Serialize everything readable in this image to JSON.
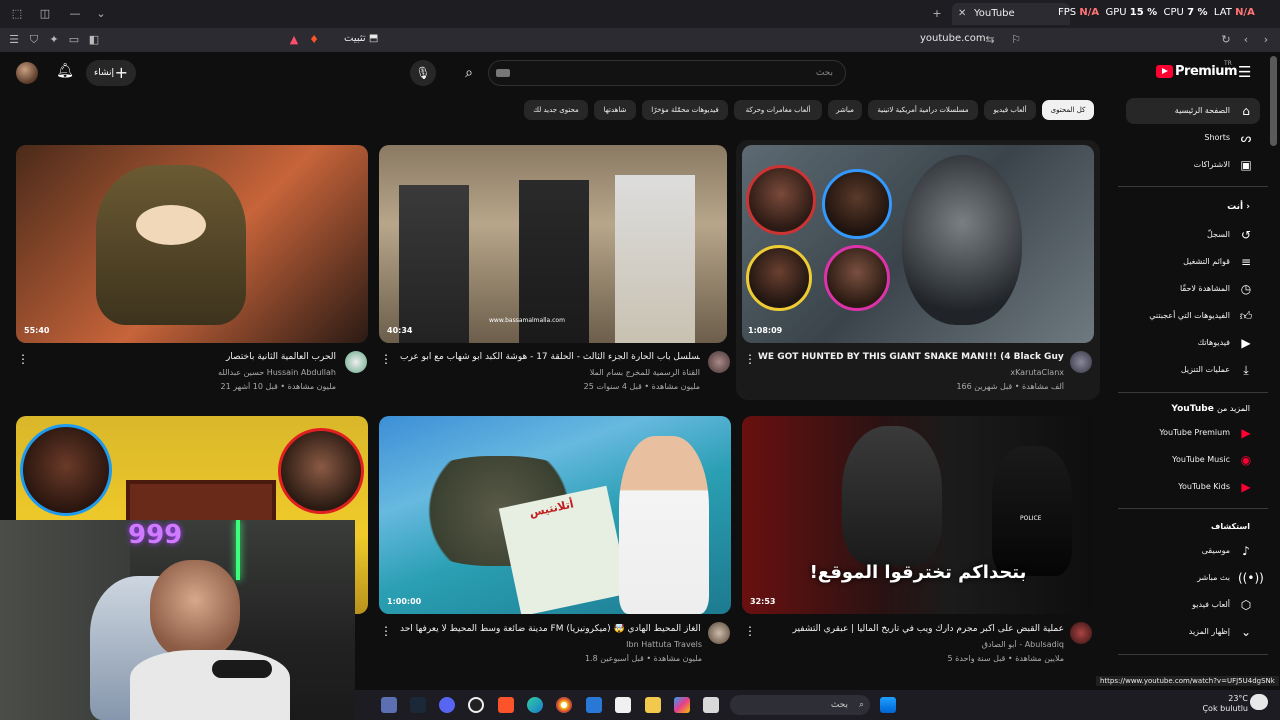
{
  "browser": {
    "tab_title": "YouTube",
    "hud_text_fps": "FPS",
    "hud_fps_value": "N/A",
    "hud_gpu": "GPU",
    "hud_gpu_value": "15 %",
    "hud_cpu": "CPU",
    "hud_cpu_value": "7 %",
    "hud_lat": "LAT",
    "hud_lat_value": "N/A",
    "url": "youtube.com",
    "install_label": "تثبيت"
  },
  "header": {
    "create_label": "إنشاء",
    "search_placeholder": "بحث",
    "logo_text": "Premium",
    "logo_region": "TR"
  },
  "chips": [
    "كل المحتوى",
    "ألعاب فيديو",
    "مسلسلات درامية أمريكية لاتينية",
    "مباشر",
    "ألعاب مغامرات وحركة",
    "فيديوهات محمّلة مؤخرًا",
    "شاهدتها",
    "محتوى جديد لك"
  ],
  "sidebar": {
    "main": [
      {
        "label": "الصفحة الرئيسية",
        "icon": "home-icon"
      },
      {
        "label": "Shorts",
        "icon": "shorts-icon"
      },
      {
        "label": "الاشتراكات",
        "icon": "subscriptions-icon"
      }
    ],
    "you_header": "أنت",
    "you": [
      {
        "label": "السجلّ",
        "icon": "history-icon"
      },
      {
        "label": "قوائم التشغيل",
        "icon": "playlists-icon"
      },
      {
        "label": "المشاهدة لاحقًا",
        "icon": "watch-later-icon"
      },
      {
        "label": "الفيديوهات التي أعجبتني",
        "icon": "like-icon"
      },
      {
        "label": "فيديوهاتك",
        "icon": "your-videos-icon"
      },
      {
        "label": "عمليات التنزيل",
        "icon": "download-icon"
      }
    ],
    "more_header": "المزيد من",
    "more_header_brand": "YouTube",
    "more": [
      {
        "label": "YouTube Premium",
        "icon": "yt-premium-icon"
      },
      {
        "label": "YouTube Music",
        "icon": "yt-music-icon"
      },
      {
        "label": "YouTube Kids",
        "icon": "yt-kids-icon"
      }
    ],
    "explore_header": "استكشاف",
    "explore": [
      {
        "label": "موسيقى",
        "icon": "music-icon"
      },
      {
        "label": "بث مباشر",
        "icon": "live-icon"
      },
      {
        "label": "ألعاب فيديو",
        "icon": "gaming-icon"
      },
      {
        "label": "إظهار المزيد",
        "icon": "chevron-down-icon"
      }
    ]
  },
  "videos": [
    {
      "title": "WE GOT HUNTED BY THIS GIANT SNAKE MAN!!! (4 Black Guys)",
      "channel": "xKarutaClanx",
      "meta": "166 ألف مشاهدة • قبل شهرين",
      "duration": "1:08:09"
    },
    {
      "title": "مسلسل باب الحارة الجزء الثالث - الحلقة 17 - هوشة الكبد ابو شهاب مع ابو عرب",
      "channel": "القناة الرسمية للمخرج بسام الملا",
      "meta": "25 مليون مشاهدة • قبل 4 سنوات",
      "duration": "40:34",
      "watermark": "www.bassamalmalla.com"
    },
    {
      "title": "الحرب العالمية الثانية باختصار",
      "channel": "حسين عبدالله Hussain Abdullah",
      "meta": "21 مليون مشاهدة • قبل 10 أشهر",
      "duration": "55:40"
    },
    {
      "title": "عملية القبض على اكبر مجرم دارك ويب في تاريخ الماليا | عبقري التشفير",
      "channel": "أبو الصادق - Abulsadiq",
      "meta": "5 ملايين مشاهدة • قبل سنة واحدة",
      "duration": "32:53",
      "thumb_text": "بتحداكم تخترقوا الموقع!",
      "thumb_badge": "POLICE"
    },
    {
      "title": "مدينة ضائعة وسط المحيط لا يعرفها أحد FM أكبر ألغاز المحيط الهادي 🤯 (ميكرونيزيا)",
      "channel": "Ibn Hattuta Travels",
      "meta": "1.8 مليون مشاهدة • قبل أسبوعين",
      "duration": "1:00:00",
      "thumb_text": "أتلانتيس"
    },
    {
      "title": "",
      "channel": "",
      "meta": "",
      "duration": "",
      "thumb_text": "999"
    }
  ],
  "status_url": "https://www.youtube.com/watch?v=UFJ5U4dgSNk",
  "taskbar": {
    "search_label": "بحث"
  },
  "weather": {
    "temp": "23°C",
    "desc": "Çok bulutlu"
  },
  "colors": {
    "accent": "#ff0033",
    "bg": "#0f0f0f",
    "chip": "#272727"
  }
}
